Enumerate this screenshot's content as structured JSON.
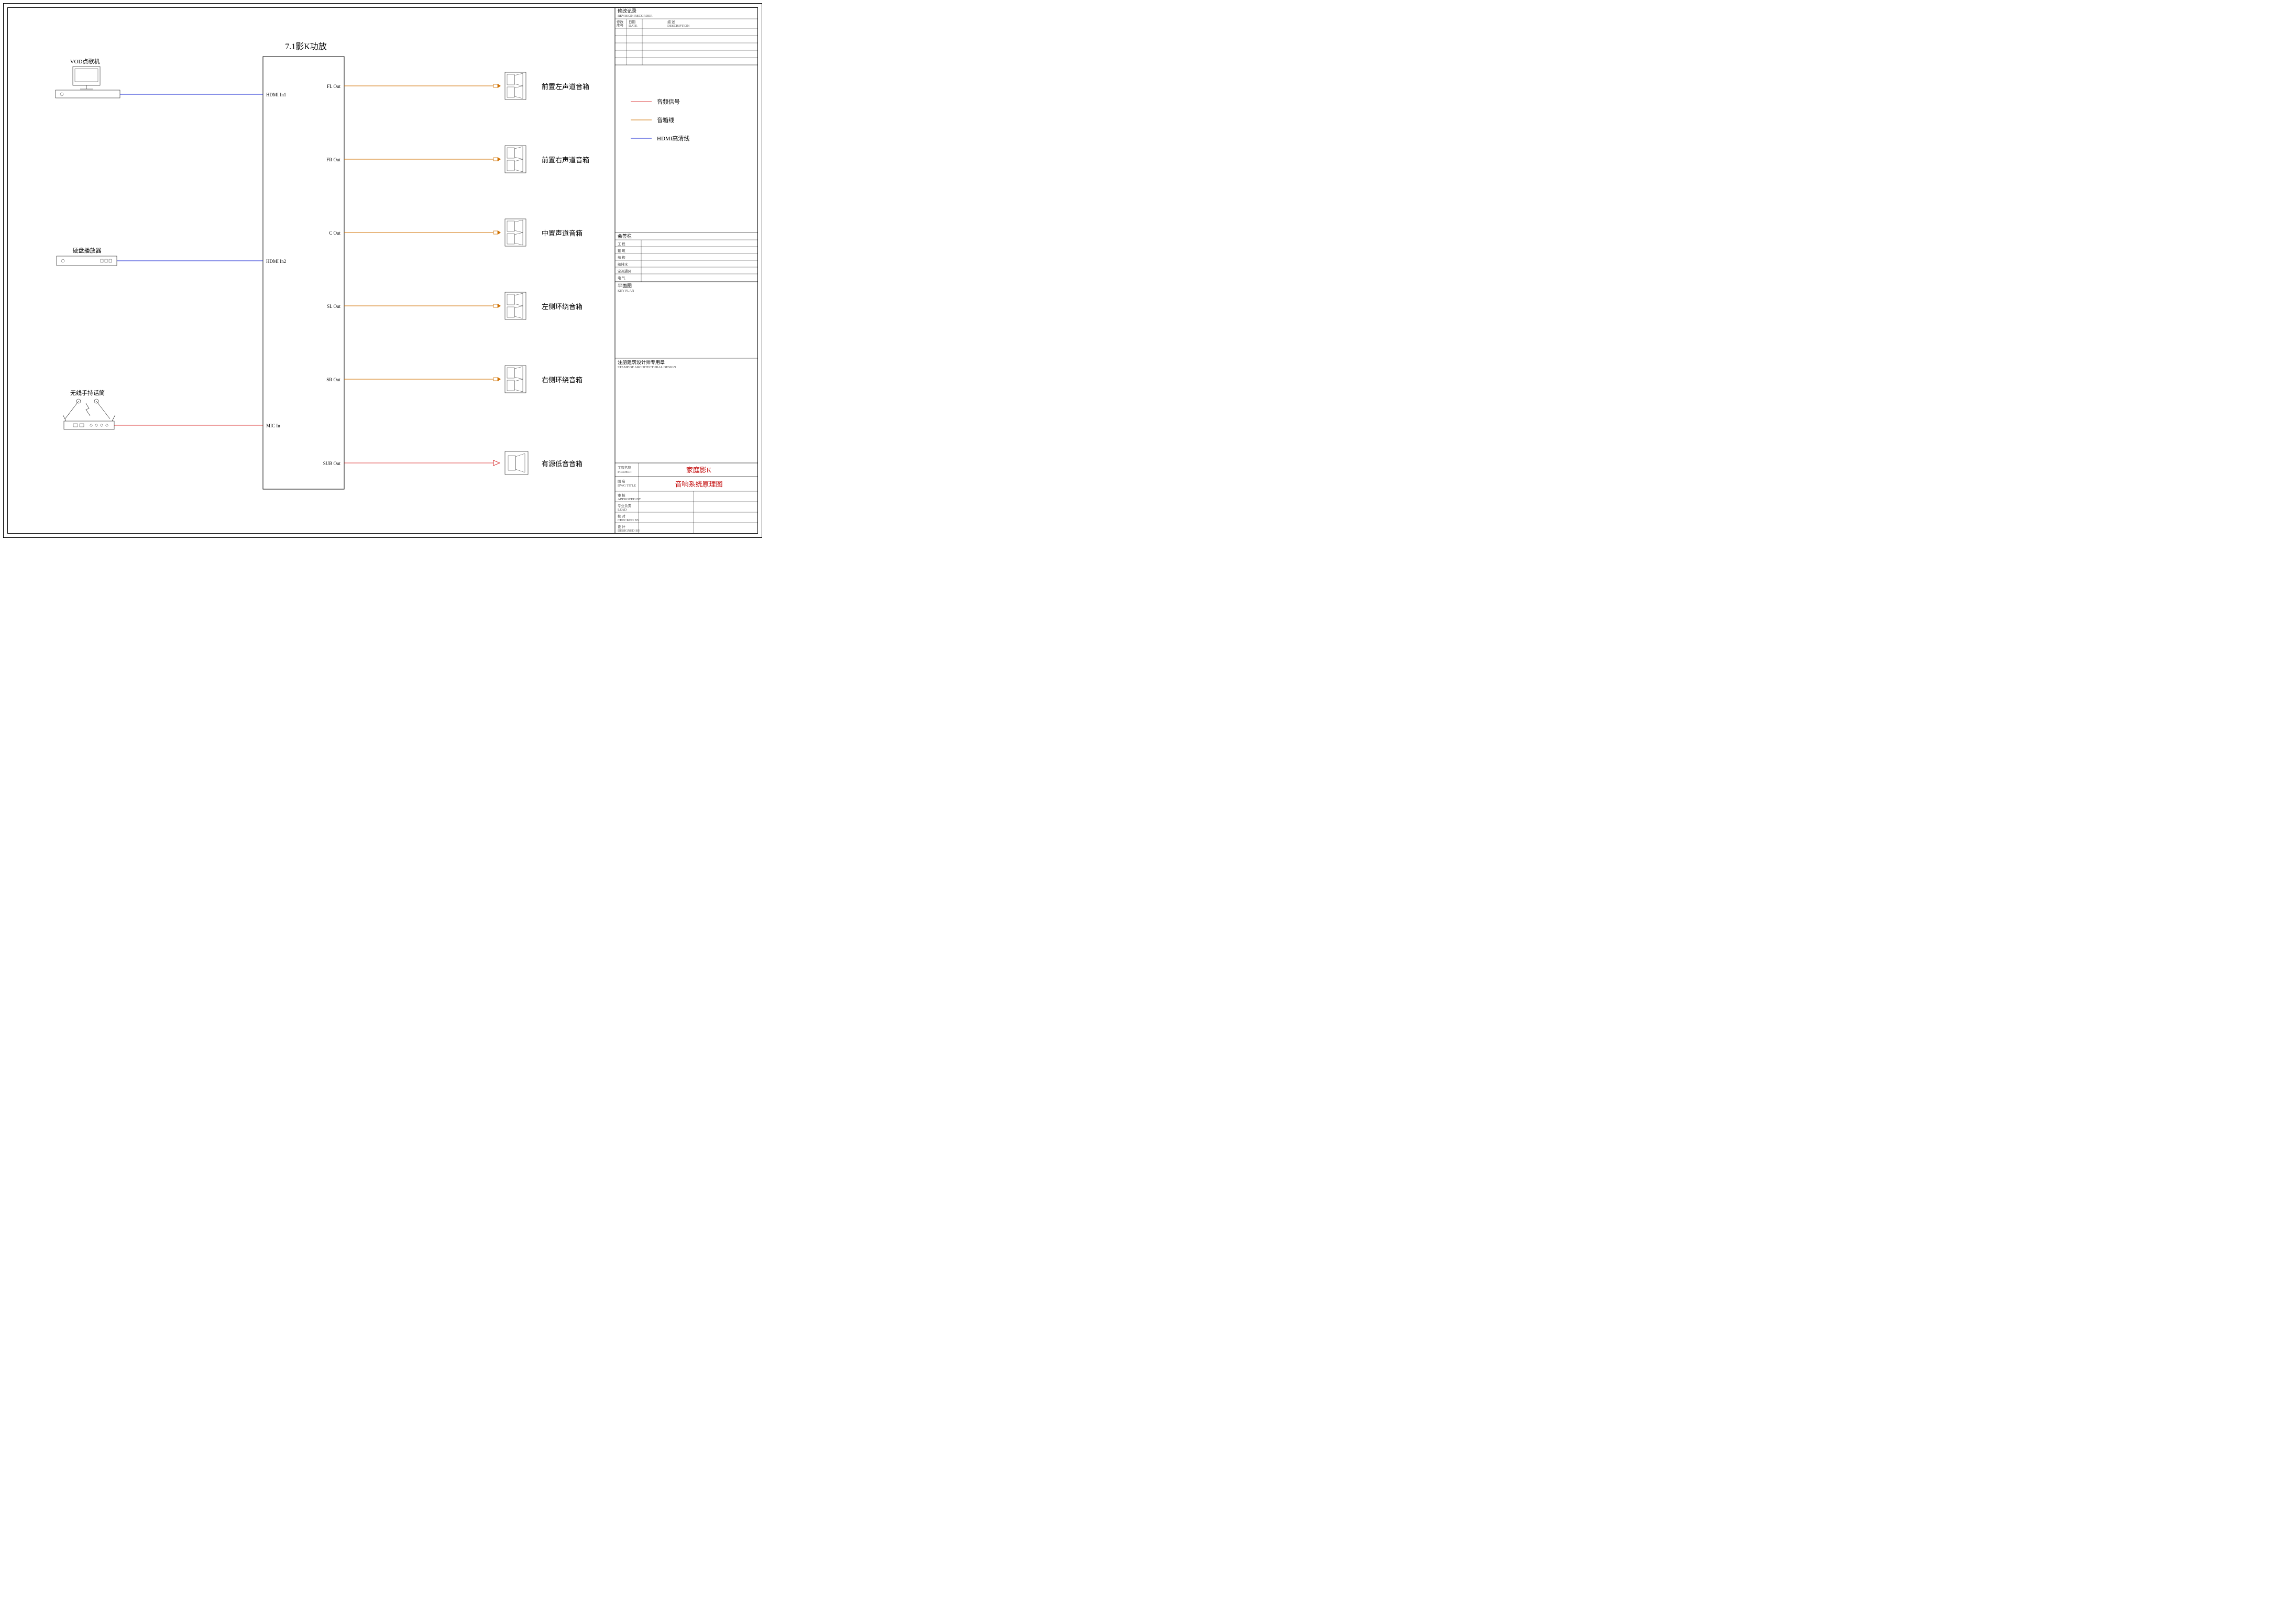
{
  "amp": {
    "title": "7.1影K功放",
    "inputs": [
      {
        "port": "HDMI In1"
      },
      {
        "port": "HDMI In2"
      },
      {
        "port": "MIC In"
      }
    ],
    "outputs": [
      {
        "port": "FL Out",
        "speaker": "前置左声道音箱"
      },
      {
        "port": "FR Out",
        "speaker": "前置右声道音箱"
      },
      {
        "port": "C Out",
        "speaker": "中置声道音箱"
      },
      {
        "port": "SL Out",
        "speaker": "左侧环绕音箱"
      },
      {
        "port": "SR Out",
        "speaker": "右侧环绕音箱"
      },
      {
        "port": "SUB Out",
        "speaker": "有源低音音箱"
      }
    ]
  },
  "sources": {
    "vod": "VOD点歌机",
    "hdd": "硬盘播放器",
    "mic": "无线手持话筒"
  },
  "legend": {
    "audio": "音频信号",
    "speaker": "音箱线",
    "hdmi": "HDMI高清线"
  },
  "titleblock": {
    "revision_header": "修改记录",
    "revision_header_en": "REVISION RECORDER",
    "rev_col1_a": "修改",
    "rev_col1_b": "序号",
    "rev_col2_a": "日期",
    "rev_col2_b": "DATE",
    "rev_col3_a": "描  述",
    "rev_col3_b": "DESCRIPTION",
    "meeting_header": "会签栏",
    "meeting_rows": [
      "工 程",
      "建 筑",
      "结 构",
      "给排水",
      "空调通风",
      "电 气"
    ],
    "plan_header": "平面图",
    "plan_header_en": "KEY PLAN",
    "stamp_header": "注册建筑设计师专用章",
    "stamp_header_en": "STAMP OF ARCHITECTURAL DESIGN",
    "rows": {
      "project_label": "工程名称",
      "project_label_en": "PROJECT",
      "project_value": "家庭影K",
      "title_label": "图 名",
      "title_label_en": "DWG TITLE",
      "title_value": "音响系统原理图",
      "review_label": "审 核",
      "review_label_en": "APPROVED BY",
      "lead_label": "专业负责",
      "lead_label_en": "LEAD",
      "check_label": "校 对",
      "check_label_en": "CHECKED BY",
      "design_label": "设 计",
      "design_label_en": "DESIGNED BY"
    }
  }
}
